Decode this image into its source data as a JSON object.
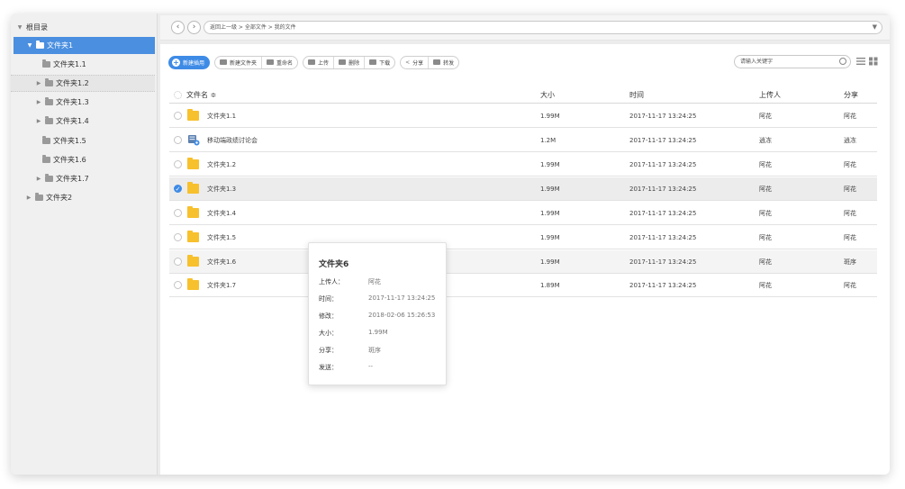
{
  "sidebar": {
    "root_label": "根目录",
    "items": [
      {
        "label": "文件夹1",
        "expander": "▼",
        "selected": true
      },
      {
        "label": "文件夹1.1",
        "expander": ""
      },
      {
        "label": "文件夹1.2",
        "expander": "▶"
      },
      {
        "label": "文件夹1.3",
        "expander": "▶"
      },
      {
        "label": "文件夹1.4",
        "expander": "▶"
      },
      {
        "label": "文件夹1.5",
        "expander": ""
      },
      {
        "label": "文件夹1.6",
        "expander": ""
      },
      {
        "label": "文件夹1.7",
        "expander": "▶"
      },
      {
        "label": "文件夹2",
        "expander": "▶"
      }
    ]
  },
  "topbar": {
    "back": "‹",
    "forward": "›",
    "path": "返回上一级 > 全部文件 > 我的文件",
    "dropdown": "▼"
  },
  "toolbar": {
    "new_label": "新建插用",
    "new_folder": "新建文件夹",
    "rename": "重命名",
    "upload": "上传",
    "delete": "删除",
    "download": "下载",
    "share": "分享",
    "transfer": "转发"
  },
  "search": {
    "placeholder": "请输入关键字"
  },
  "table": {
    "headers": {
      "name": "文件名 ≑",
      "size": "大小",
      "time": "时间",
      "uploader": "上传人",
      "share": "分享"
    },
    "rows": [
      {
        "name": "文件夹1.1",
        "size": "1.99M",
        "time": "2017-11-17 13:24:25",
        "uploader": "阿花",
        "share": "阿花",
        "icon": "folder",
        "checked": false
      },
      {
        "name": "移动端政绩讨论会",
        "size": "1.2M",
        "time": "2017-11-17 13:24:25",
        "uploader": "逍冻",
        "share": "逍冻",
        "icon": "app",
        "checked": false
      },
      {
        "name": "文件夹1.2",
        "size": "1.99M",
        "time": "2017-11-17 13:24:25",
        "uploader": "阿花",
        "share": "阿花",
        "icon": "folder",
        "checked": false
      },
      {
        "name": "文件夹1.3",
        "size": "1.99M",
        "time": "2017-11-17 13:24:25",
        "uploader": "阿花",
        "share": "阿花",
        "icon": "folder",
        "checked": true
      },
      {
        "name": "文件夹1.4",
        "size": "1.99M",
        "time": "2017-11-17 13:24:25",
        "uploader": "阿花",
        "share": "阿花",
        "icon": "folder",
        "checked": false
      },
      {
        "name": "文件夹1.5",
        "size": "1.99M",
        "time": "2017-11-17 13:24:25",
        "uploader": "阿花",
        "share": "阿花",
        "icon": "folder",
        "checked": false
      },
      {
        "name": "文件夹1.6",
        "size": "1.99M",
        "time": "2017-11-17 13:24:25",
        "uploader": "阿花",
        "share": "斑序",
        "icon": "folder",
        "checked": false
      },
      {
        "name": "文件夹1.7",
        "size": "1.89M",
        "time": "2017-11-17 13:24:25",
        "uploader": "阿花",
        "share": "阿花",
        "icon": "folder",
        "checked": false
      }
    ]
  },
  "popup": {
    "title": "文件夹6",
    "lines": [
      {
        "label": "上传人：",
        "value": "阿花"
      },
      {
        "label": "时间：",
        "value": "2017-11-17 13:24:25"
      },
      {
        "label": "修改：",
        "value": "2018-02-06 15:26:53"
      },
      {
        "label": "大小：",
        "value": "1.99M"
      },
      {
        "label": "分享：",
        "value": "斑序"
      },
      {
        "label": "发送：",
        "value": "--"
      }
    ]
  },
  "colors": {
    "accent": "#3e8be6",
    "folder": "#f7c02d",
    "selected_tree": "#4a8fe0"
  }
}
